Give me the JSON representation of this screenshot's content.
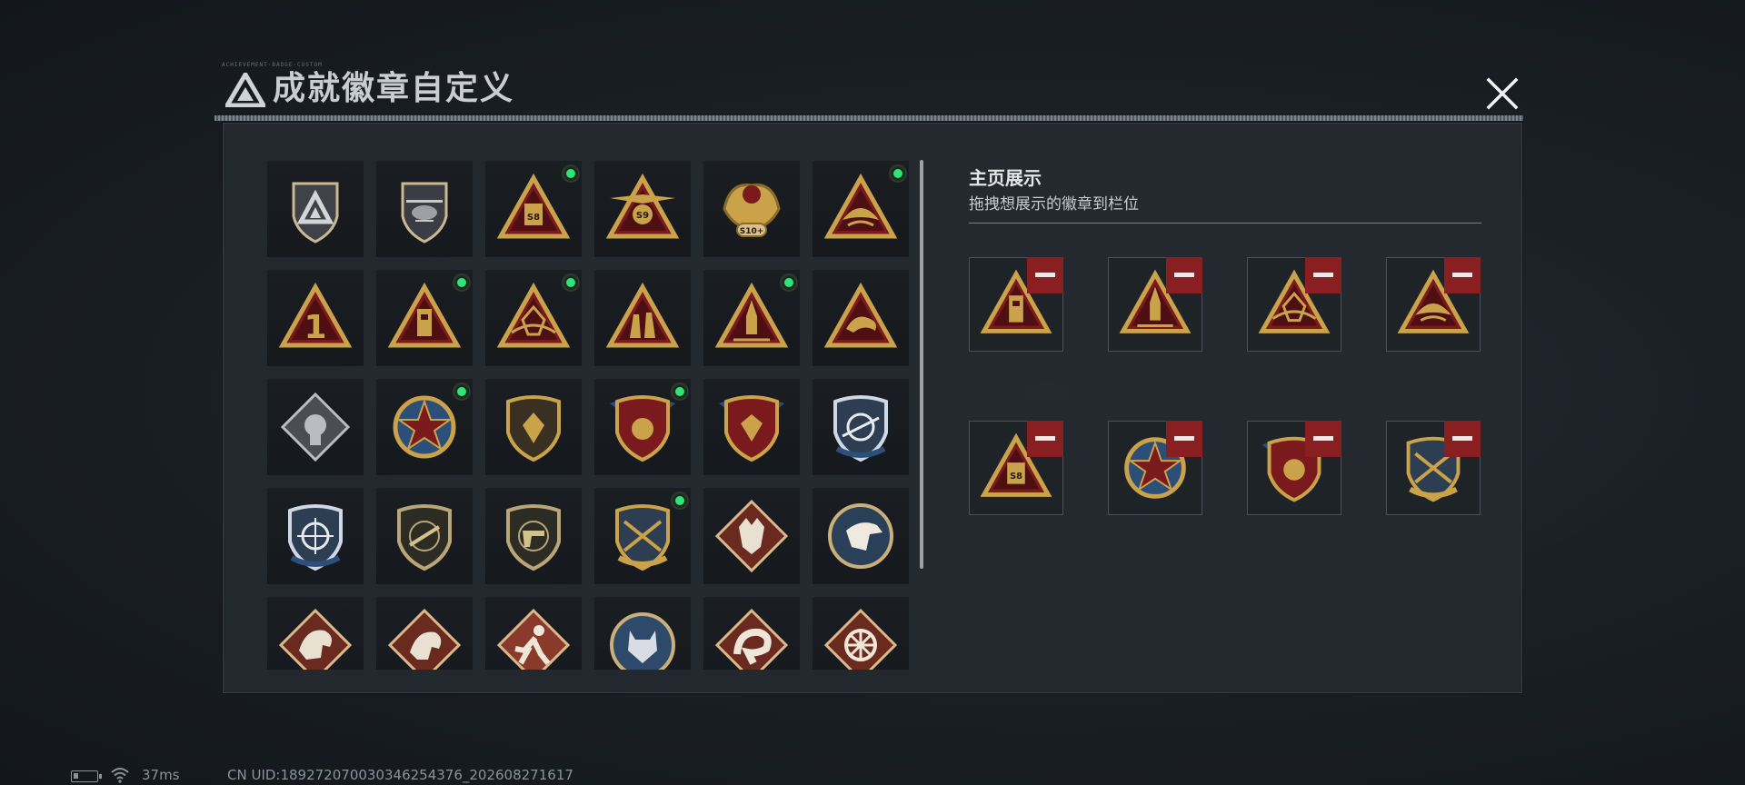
{
  "dialog": {
    "title": "成就徽章自定义",
    "tiny_label": "ACHIEVEMENT·BADGE·CUSTOM"
  },
  "display": {
    "title": "主页展示",
    "subtitle": "拖拽想展示的徽章到栏位"
  },
  "status": {
    "ping": "37ms",
    "uid": "CN UID:18927207003034625437​6_202608271617"
  },
  "colors": {
    "accent_green": "#2ee577",
    "remove_red": "#8a1f22",
    "badge_gold": "#c9a24a",
    "badge_red": "#7a1a1c"
  },
  "badges": [
    {
      "icon": "gray-shield-logo-icon",
      "new": false
    },
    {
      "icon": "helicopter-shield-icon",
      "new": false
    },
    {
      "icon": "s8-triangle-icon",
      "new": true
    },
    {
      "icon": "s9-winged-triangle-icon",
      "new": false
    },
    {
      "icon": "s10-eagle-crest-icon",
      "new": false
    },
    {
      "icon": "golden-bird-triangle-icon",
      "new": true
    },
    {
      "icon": "number-one-triangle-icon",
      "new": false
    },
    {
      "icon": "tower-triangle-icon",
      "new": true
    },
    {
      "icon": "flower-triangle-icon",
      "new": true
    },
    {
      "icon": "soldiers-triangle-icon",
      "new": false
    },
    {
      "icon": "rocket-triangle-icon",
      "new": true
    },
    {
      "icon": "fish-triangle-icon",
      "new": false
    },
    {
      "icon": "silver-fist-diamond-icon",
      "new": false
    },
    {
      "icon": "star-medal-icon",
      "new": true
    },
    {
      "icon": "gold-shield-icon",
      "new": false
    },
    {
      "icon": "winged-shield-icon",
      "new": true
    },
    {
      "icon": "crowned-shield-icon",
      "new": false
    },
    {
      "icon": "sniper-shield-blue-icon",
      "new": false
    },
    {
      "icon": "crosshair-shield-icon",
      "new": false
    },
    {
      "icon": "rifle-shield-icon",
      "new": false
    },
    {
      "icon": "pistol-shield-icon",
      "new": false
    },
    {
      "icon": "crossed-rifles-shield-icon",
      "new": true
    },
    {
      "icon": "wolf-diamond-icon",
      "new": false
    },
    {
      "icon": "eagle-circle-icon",
      "new": false
    },
    {
      "icon": "dragon-diamond-icon",
      "new": false
    },
    {
      "icon": "dragon-diamond-2-icon",
      "new": false
    },
    {
      "icon": "runner-diamond-icon",
      "new": false
    },
    {
      "icon": "lynx-circle-icon",
      "new": false
    },
    {
      "icon": "serpent-diamond-icon",
      "new": false
    },
    {
      "icon": "wheel-diamond-icon",
      "new": false
    }
  ],
  "slots": [
    {
      "icon": "tower-triangle-icon"
    },
    {
      "icon": "rocket-triangle-icon"
    },
    {
      "icon": "flower-triangle-icon"
    },
    {
      "icon": "golden-bird-triangle-icon"
    },
    {
      "icon": "s8-triangle-icon"
    },
    {
      "icon": "star-medal-icon"
    },
    {
      "icon": "winged-shield-icon"
    },
    {
      "icon": "crossed-rifles-shield-icon"
    }
  ],
  "badge_text": {
    "s8": "S8",
    "s9": "S9",
    "s10": "S10+",
    "one": "1"
  }
}
